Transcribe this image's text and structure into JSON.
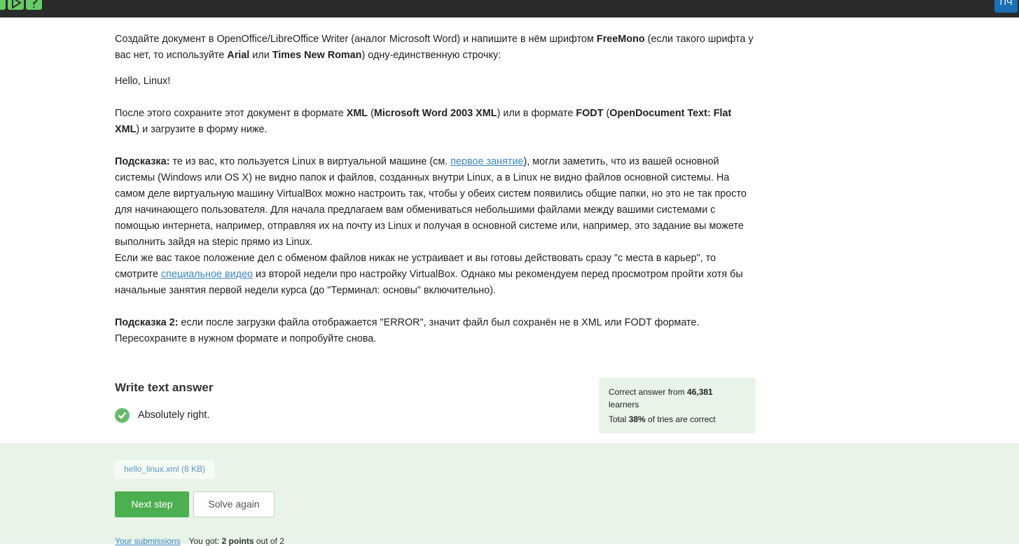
{
  "topbar": {
    "icons": [
      "collapse-icon",
      "play-icon",
      "help-icon"
    ],
    "avatar_initials": "ПЧ"
  },
  "task": {
    "p1_a": "Создайте документ в OpenOffice/LibreOffice Writer (аналог Microsoft Word) и напишите в нём шрифтом ",
    "p1_font1": "FreeMono",
    "p1_b": " (если такого шрифта у вас нет, то используйте ",
    "p1_font2": "Arial",
    "p1_c": " или ",
    "p1_font3": "Times New Roman",
    "p1_d": ") одну-единственную строчку:",
    "hello_line": "Hello, Linux!",
    "p2_a": "После этого сохраните этот документ в формате ",
    "p2_fmt1": "XML",
    "p2_b": " (",
    "p2_fmt1_full": "Microsoft Word 2003 XML",
    "p2_c": ") или в формате ",
    "p2_fmt2": "FODT",
    "p2_d": " (",
    "p2_fmt2_full": "OpenDocument Text: Flat XML",
    "p2_e": ") и загрузите в форму ниже.",
    "hint1_label": "Подсказка:",
    "hint1_a": " те из вас, кто пользуется Linux в виртуальной машине (см. ",
    "hint1_link": "первое занятие",
    "hint1_b": "), могли заметить, что из вашей основной системы (Windows или OS X) не видно папок и файлов, созданных внутри Linux, а в Linux не видно файлов основной системы. На самом деле виртуальную машину VirtualBox можно настроить так, чтобы у обеих систем появились общие папки, но это не так просто для начинающего пользователя. Для начала предлагаем вам обмениваться небольшими файлами между вашими системами с помощью интернета, например, отправляя их на почту из Linux и получая в основной системе или, например, это задание вы можете выполнить зайдя на stepic прямо из Linux.",
    "hint1_c": "Если же вас такое положение дел с обменом файлов никак не устраивает и вы готовы действовать сразу \"с места в карьер\", то смотрите ",
    "hint1_link2": "специальное видео",
    "hint1_d": " из второй недели про настройку VirtualBox. Однако мы рекомендуем перед просмотром пройти хотя бы начальные занятия первой недели курса (до \"Терминал: основы\" включительно).",
    "hint2_label": "Подсказка 2:",
    "hint2_text": " если после загрузки файла отображается \"ERROR\", значит файл был сохранён не в XML или FODT формате. Пересохраните в нужном формате и попробуйте снова."
  },
  "answer": {
    "title": "Write text answer",
    "status": "Absolutely right."
  },
  "stats": {
    "correct_prefix": "Correct answer from ",
    "learners_count": "46,381",
    "learners_suffix": "learners",
    "total_prefix": "Total ",
    "percent": "38%",
    "total_suffix": " of tries are correct"
  },
  "submission": {
    "file_label": "hello_linux.xml (8 KB)",
    "next_label": "Next step",
    "solve_again_label": "Solve again",
    "your_submissions": "Your submissions",
    "you_got": "You got: ",
    "points": "2 points",
    "out_of": " out of 2"
  },
  "colors": {
    "accent_green": "#4caf50",
    "success_bg": "#e8f4e8",
    "link": "#3a87c8",
    "topbar": "#2b2b2b",
    "avatar": "#1c6fb5"
  }
}
